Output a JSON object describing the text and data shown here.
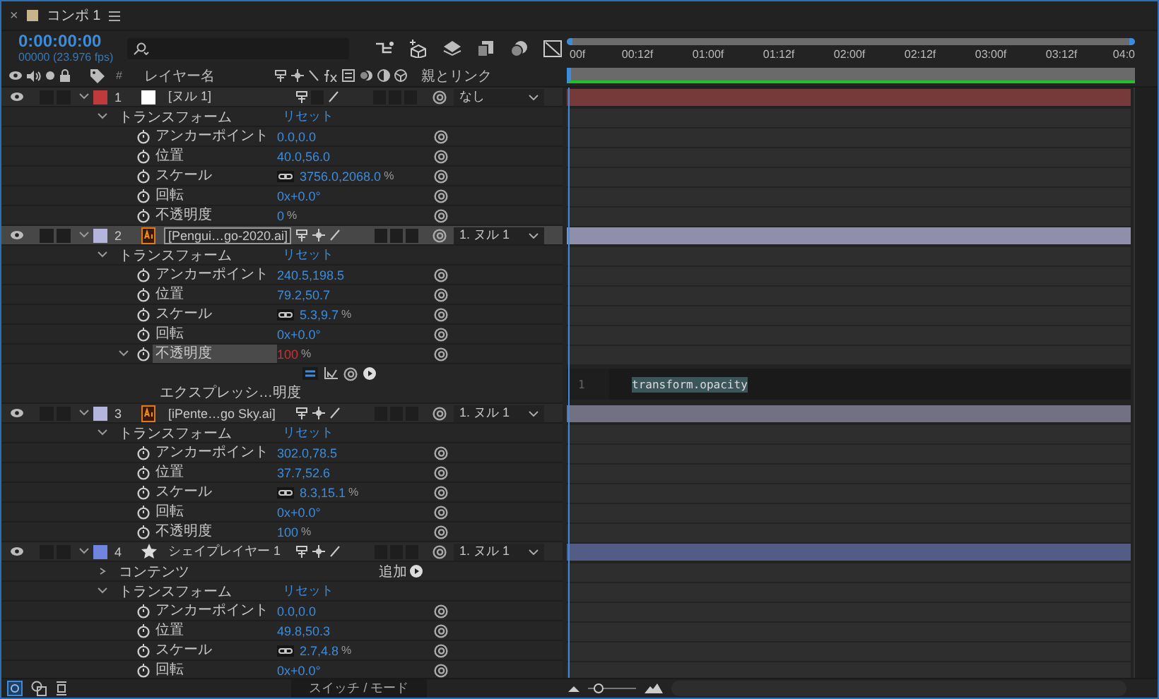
{
  "tab": {
    "close": "×",
    "title": "コンポ 1",
    "color": "#c8b48c"
  },
  "timecode": "0:00:00:00",
  "frames": "00000 (23.976 fps)",
  "columns": {
    "number": "#",
    "layer_name": "レイヤー名",
    "parent": "親とリンク"
  },
  "ruler": [
    "00f",
    "00:12f",
    "01:00f",
    "01:12f",
    "02:00f",
    "02:12f",
    "03:00f",
    "03:12f",
    "04:0"
  ],
  "layers": [
    {
      "number": "1",
      "name": "[ヌル 1]",
      "kind": "null",
      "color": "#c0393b",
      "selected": false,
      "expanded": true,
      "parent": "なし",
      "groups": [
        {
          "label": "トランスフォーム",
          "expanded": true,
          "action": "リセット",
          "properties": [
            {
              "name": "アンカーポイント",
              "value": "0.0,0.0",
              "selected": false
            },
            {
              "name": "位置",
              "value": "40.0,56.0",
              "selected": false
            },
            {
              "name": "スケール",
              "value": "3756.0,2068.0",
              "unit": "%",
              "linked": true,
              "selected": false
            },
            {
              "name": "回転",
              "value": "0x+0.0°",
              "selected": false
            },
            {
              "name": "不透明度",
              "value": "0",
              "unit": "%",
              "selected": false
            }
          ]
        }
      ]
    },
    {
      "number": "2",
      "name": "[Pengui…go-2020.ai]",
      "kind": "ai",
      "color": "#b4b4dc",
      "selected": true,
      "expanded": true,
      "parent": "1. ヌル 1",
      "groups": [
        {
          "label": "トランスフォーム",
          "expanded": true,
          "action": "リセット",
          "properties": [
            {
              "name": "アンカーポイント",
              "value": "240.5,198.5",
              "selected": false
            },
            {
              "name": "位置",
              "value": "79.2,50.7",
              "selected": false
            },
            {
              "name": "スケール",
              "value": "5.3,9.7",
              "unit": "%",
              "linked": true,
              "selected": false
            },
            {
              "name": "回転",
              "value": "0x+0.0°",
              "selected": false
            },
            {
              "name": "不透明度",
              "value": "100",
              "unit": "%",
              "selected": true,
              "expanded": true,
              "expression": {
                "label": "エクスプレッシ…明度",
                "line": "1",
                "code": "transform.opacity"
              }
            }
          ]
        }
      ]
    },
    {
      "number": "3",
      "name": "[iPente…go Sky.ai]",
      "kind": "ai",
      "color": "#b4b4dc",
      "selected": false,
      "expanded": true,
      "parent": "1. ヌル 1",
      "groups": [
        {
          "label": "トランスフォーム",
          "expanded": true,
          "action": "リセット",
          "properties": [
            {
              "name": "アンカーポイント",
              "value": "302.0,78.5",
              "selected": false
            },
            {
              "name": "位置",
              "value": "37.7,52.6",
              "selected": false
            },
            {
              "name": "スケール",
              "value": "8.3,15.1",
              "unit": "%",
              "linked": true,
              "selected": false
            },
            {
              "name": "回転",
              "value": "0x+0.0°",
              "selected": false
            },
            {
              "name": "不透明度",
              "value": "100",
              "unit": "%",
              "selected": false
            }
          ]
        }
      ]
    },
    {
      "number": "4",
      "name": "シェイプレイヤー 1",
      "kind": "shape",
      "color": "#6f86e0",
      "selected": false,
      "expanded": true,
      "parent": "1. ヌル 1",
      "groups": [
        {
          "label": "コンテンツ",
          "expanded": false,
          "action": "追加"
        },
        {
          "label": "トランスフォーム",
          "expanded": true,
          "action": "リセット",
          "properties": [
            {
              "name": "アンカーポイント",
              "value": "0.0,0.0",
              "selected": false
            },
            {
              "name": "位置",
              "value": "49.8,50.3",
              "selected": false
            },
            {
              "name": "スケール",
              "value": "2.7,4.8",
              "unit": "%",
              "linked": true,
              "selected": false
            },
            {
              "name": "回転",
              "value": "0x+0.0°",
              "selected": false
            }
          ]
        }
      ]
    }
  ],
  "bottom": {
    "mode_button": "スイッチ / モード",
    "zoom": {
      "level": 0.12
    }
  }
}
